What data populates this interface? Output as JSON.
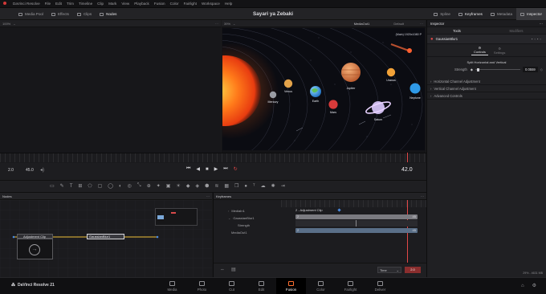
{
  "app": {
    "menu": [
      "DaVinci Resolve",
      "File",
      "Edit",
      "Trim",
      "Timeline",
      "Clip",
      "Mark",
      "View",
      "Playback",
      "Fusion",
      "Color",
      "Fairlight",
      "Workspace",
      "Help"
    ]
  },
  "toolbar": {
    "left": [
      "Media Pool",
      "Effects",
      "Clips",
      "Nodes"
    ],
    "title": "Sayari ya Zebaki",
    "right": [
      "Spline",
      "Keyframes",
      "Metadata",
      "Inspector"
    ]
  },
  "viewer_left": {
    "zoom": "100%"
  },
  "viewer_right": {
    "zoom": "39%",
    "name": "MediaOut1",
    "lut": "Default",
    "resolution": "(Main) 1920x1080 P"
  },
  "planets": [
    "Mercury",
    "Venus",
    "Earth",
    "Mars",
    "Jupiter",
    "Saturn",
    "Uranus",
    "Neptune"
  ],
  "transport": {
    "start": "2.0",
    "end": "45.0",
    "current": "42.0"
  },
  "nodes": {
    "title": "Nodes",
    "adjust_clip": "Adjustment Clip",
    "blur": "GaussianBlur1"
  },
  "keyframes": {
    "title": "Keyframes",
    "tracks": [
      "MediaIn1",
      "GaussianBlur1",
      "Strength",
      "MediaOut1"
    ],
    "clip_label": "2 - Adjustment Clip",
    "bar_start": "2",
    "bar_end": "45",
    "time_label": "Time",
    "time_value": "2.0"
  },
  "inspector": {
    "title": "Inspector",
    "tabs": [
      "Tools",
      "Modifiers"
    ],
    "node_name": "GaussianBlur1",
    "subtabs": [
      "Controls",
      "Settings"
    ],
    "split_label": "Split Horizontal and Vertical",
    "strength_label": "Strength",
    "strength_value": "0.0559",
    "sections": [
      "Horizontal Channel Adjustment",
      "Vertical Channel Adjustment",
      "Advanced Controls"
    ],
    "status": "29% - 4631 MB"
  },
  "pagebar": {
    "brand": "DaVinci Resolve 21",
    "pages": [
      "Media",
      "Photo",
      "Cut",
      "Edit",
      "Fusion",
      "Color",
      "Fairlight",
      "Deliver"
    ],
    "active": "Fusion"
  },
  "colors": {
    "accent": "#e23c3c",
    "orange": "#ff7a2a",
    "keyframe_bar": "#5a6f88",
    "timebar_red": "#d24a4a"
  }
}
